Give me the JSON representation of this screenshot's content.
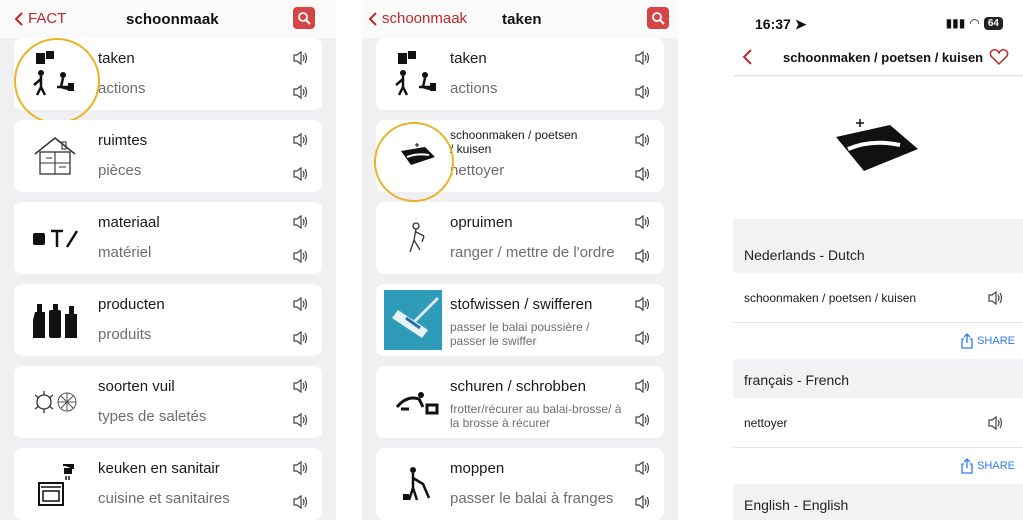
{
  "screen1": {
    "back_label": "FACT",
    "title": "schoonmaak",
    "items": [
      {
        "nl": "taken",
        "fr": "actions",
        "icon": "cleaning-people-icon"
      },
      {
        "nl": "ruimtes",
        "fr": "pièces",
        "icon": "house-icon"
      },
      {
        "nl": "materiaal",
        "fr": "matériel",
        "icon": "cleaning-tools-icon"
      },
      {
        "nl": "producten",
        "fr": "produits",
        "icon": "bottles-icon"
      },
      {
        "nl": "soorten vuil",
        "fr": "types de saletés",
        "icon": "dirt-icon"
      },
      {
        "nl": "keuken en sanitair",
        "fr": "cuisine et sanitaires",
        "icon": "kitchen-icon"
      }
    ]
  },
  "screen2": {
    "back_label": "schoonmaak",
    "title": "taken",
    "items": [
      {
        "nl": "taken",
        "fr": "actions",
        "icon": "cleaning-people-icon"
      },
      {
        "nl": "schoonmaken / poetsen / kuisen",
        "fr": "nettoyer",
        "icon": "sponge-icon"
      },
      {
        "nl": "opruimen",
        "fr": "ranger / mettre de l'ordre",
        "icon": "tidy-person-icon"
      },
      {
        "nl": "stofwissen / swifferen",
        "fr": "passer le balai poussière / passer le swiffer",
        "icon": "swiffer-photo-icon"
      },
      {
        "nl": "schuren / schrobben",
        "fr": "frotter/récurer au balai-brosse/ à la brosse à récurer",
        "icon": "scrubbing-person-icon"
      },
      {
        "nl": "moppen",
        "fr": "passer le balai à franges",
        "icon": "mop-person-icon"
      }
    ]
  },
  "screen3": {
    "time": "16:37",
    "battery": "64",
    "title": "schoonmaken / poetsen / kuisen",
    "sections": [
      {
        "header": "Nederlands - Dutch",
        "word": "schoonmaken / poetsen / kuisen",
        "share": "SHARE"
      },
      {
        "header": "français - French",
        "word": "nettoyer",
        "share": "SHARE"
      },
      {
        "header": "English - English"
      }
    ]
  },
  "colors": {
    "accent": "#c02a2a",
    "highlight": "#e8b422",
    "link": "#2e7cf0"
  }
}
